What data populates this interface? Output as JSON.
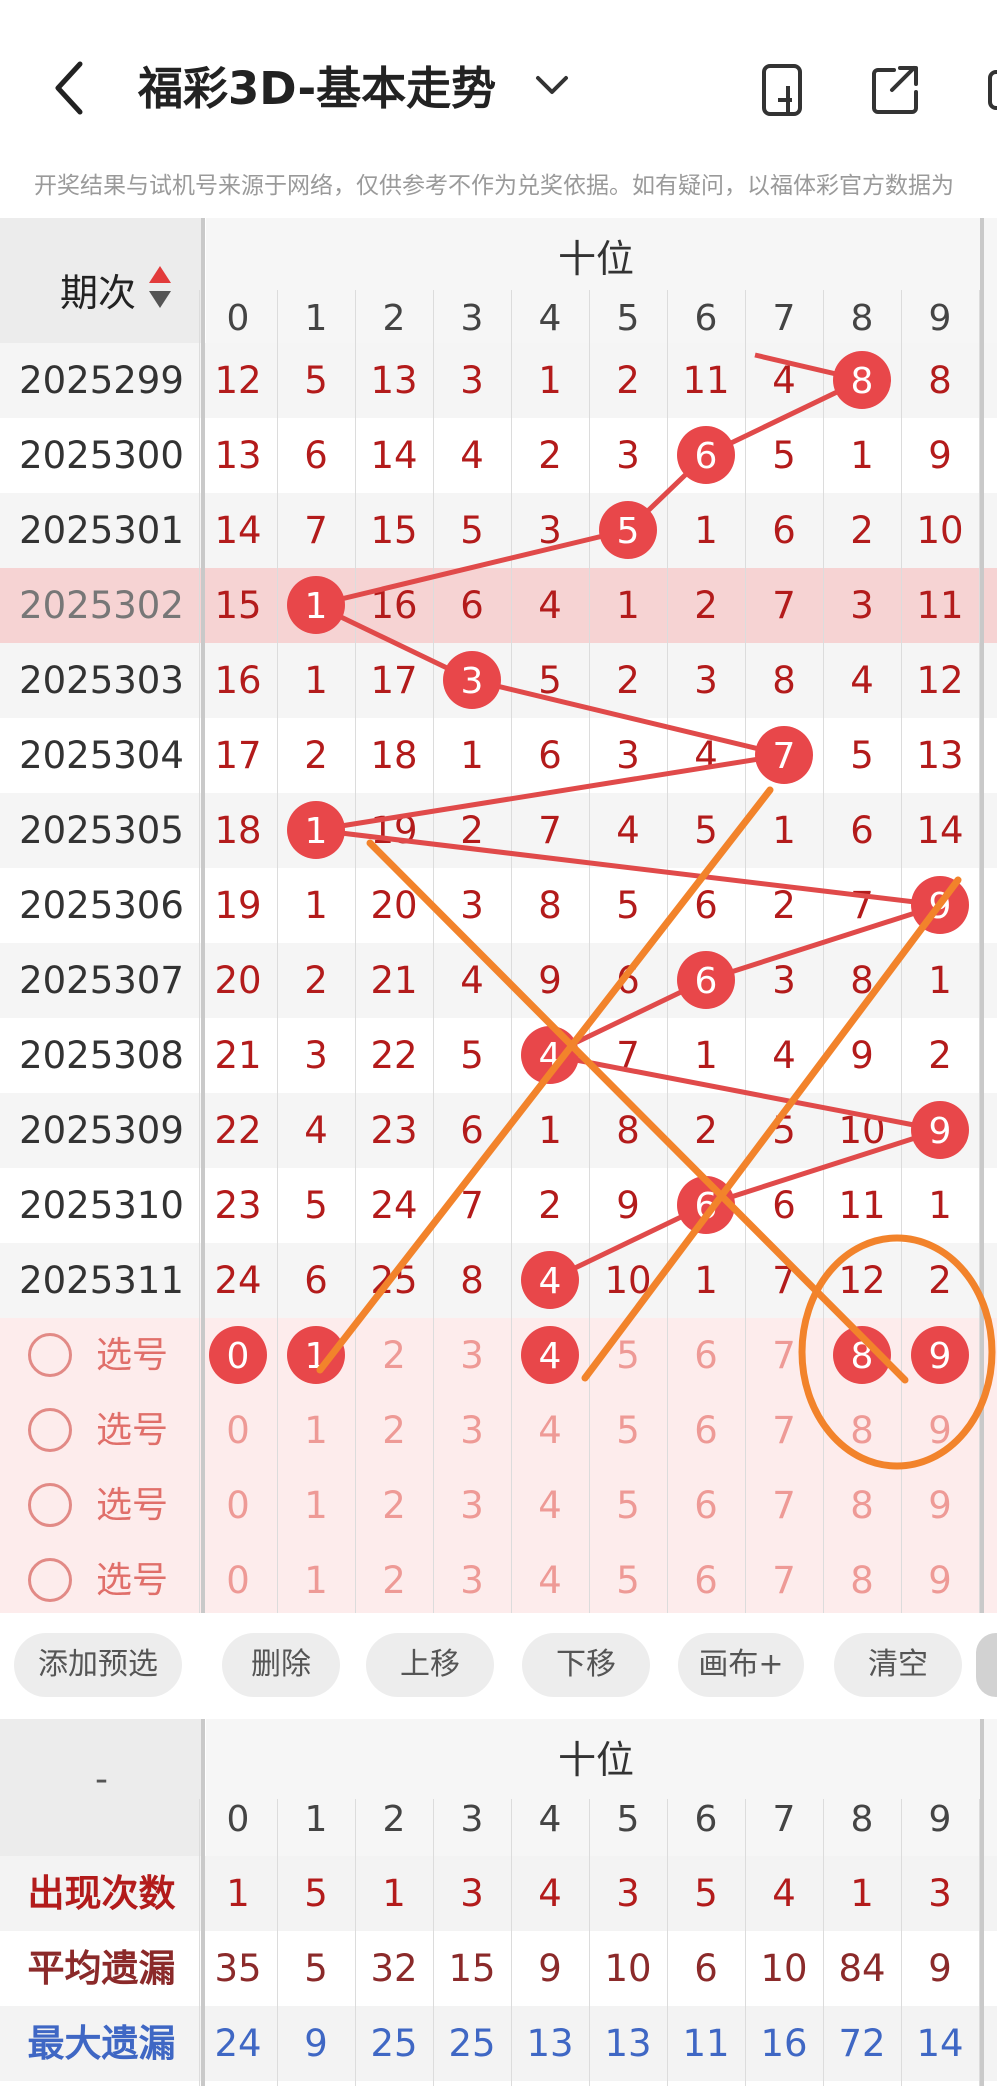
{
  "header": {
    "title": "福彩3D-基本走势",
    "notice": "开奖结果与试机号来源于网络，仅供参考不作为兑奖依据。如有疑问，以福体彩官方数据为"
  },
  "table": {
    "period_header": "期次",
    "group_title": "十位",
    "digits": [
      "0",
      "1",
      "2",
      "3",
      "4",
      "5",
      "6",
      "7",
      "8",
      "9"
    ],
    "rows": [
      {
        "period": "2025299",
        "values": [
          "12",
          "5",
          "13",
          "3",
          "1",
          "2",
          "11",
          "4",
          "8",
          "8"
        ],
        "hit": 8
      },
      {
        "period": "2025300",
        "values": [
          "13",
          "6",
          "14",
          "4",
          "2",
          "3",
          "6",
          "5",
          "1",
          "9"
        ],
        "hit": 6
      },
      {
        "period": "2025301",
        "values": [
          "14",
          "7",
          "15",
          "5",
          "3",
          "5",
          "1",
          "6",
          "2",
          "10"
        ],
        "hit": 5
      },
      {
        "period": "2025302",
        "values": [
          "15",
          "1",
          "16",
          "6",
          "4",
          "1",
          "2",
          "7",
          "3",
          "11"
        ],
        "hit": 1
      },
      {
        "period": "2025303",
        "values": [
          "16",
          "1",
          "17",
          "3",
          "5",
          "2",
          "3",
          "8",
          "4",
          "12"
        ],
        "hit": 3
      },
      {
        "period": "2025304",
        "values": [
          "17",
          "2",
          "18",
          "1",
          "6",
          "3",
          "4",
          "7",
          "5",
          "13"
        ],
        "hit": 7
      },
      {
        "period": "2025305",
        "values": [
          "18",
          "1",
          "19",
          "2",
          "7",
          "4",
          "5",
          "1",
          "6",
          "14"
        ],
        "hit": 1
      },
      {
        "period": "2025306",
        "values": [
          "19",
          "1",
          "20",
          "3",
          "8",
          "5",
          "6",
          "2",
          "7",
          "9"
        ],
        "hit": 9
      },
      {
        "period": "2025307",
        "values": [
          "20",
          "2",
          "21",
          "4",
          "9",
          "6",
          "6",
          "3",
          "8",
          "1"
        ],
        "hit": 6
      },
      {
        "period": "2025308",
        "values": [
          "21",
          "3",
          "22",
          "5",
          "4",
          "7",
          "1",
          "4",
          "9",
          "2"
        ],
        "hit": 4
      },
      {
        "period": "2025309",
        "values": [
          "22",
          "4",
          "23",
          "6",
          "1",
          "8",
          "2",
          "5",
          "10",
          "9"
        ],
        "hit": 9
      },
      {
        "period": "2025310",
        "values": [
          "23",
          "5",
          "24",
          "7",
          "2",
          "9",
          "6",
          "6",
          "11",
          "1"
        ],
        "hit": 6
      },
      {
        "period": "2025311",
        "values": [
          "24",
          "6",
          "25",
          "8",
          "4",
          "10",
          "1",
          "7",
          "12",
          "2"
        ],
        "hit": 4
      }
    ],
    "select_rows": [
      {
        "label": "选号",
        "selected": [
          0,
          1,
          4,
          8,
          9
        ]
      },
      {
        "label": "选号",
        "selected": []
      },
      {
        "label": "选号",
        "selected": []
      },
      {
        "label": "选号",
        "selected": []
      }
    ]
  },
  "toolbar": {
    "buttons": [
      "添加预选",
      "删除",
      "上移",
      "下移",
      "画布+",
      "清空"
    ]
  },
  "stats": {
    "corner": "-",
    "group_title": "十位",
    "digits": [
      "0",
      "1",
      "2",
      "3",
      "4",
      "5",
      "6",
      "7",
      "8",
      "9"
    ],
    "rows": [
      {
        "label": "出现次数",
        "values": [
          "1",
          "5",
          "1",
          "3",
          "4",
          "3",
          "5",
          "4",
          "1",
          "3"
        ],
        "color": "#b31b1b"
      },
      {
        "label": "平均遗漏",
        "values": [
          "35",
          "5",
          "32",
          "15",
          "9",
          "10",
          "6",
          "10",
          "84",
          "9"
        ],
        "color": "#8b2a2a"
      },
      {
        "label": "最大遗漏",
        "values": [
          "24",
          "9",
          "25",
          "25",
          "13",
          "13",
          "11",
          "16",
          "72",
          "14"
        ],
        "color": "#3f67c4"
      }
    ]
  },
  "colors": {
    "accent": "#e8474a",
    "line": "#e04a4a",
    "orange": "#f2832b",
    "highlight_row": "#f6d3d3",
    "select_bg": "#fdecec"
  }
}
